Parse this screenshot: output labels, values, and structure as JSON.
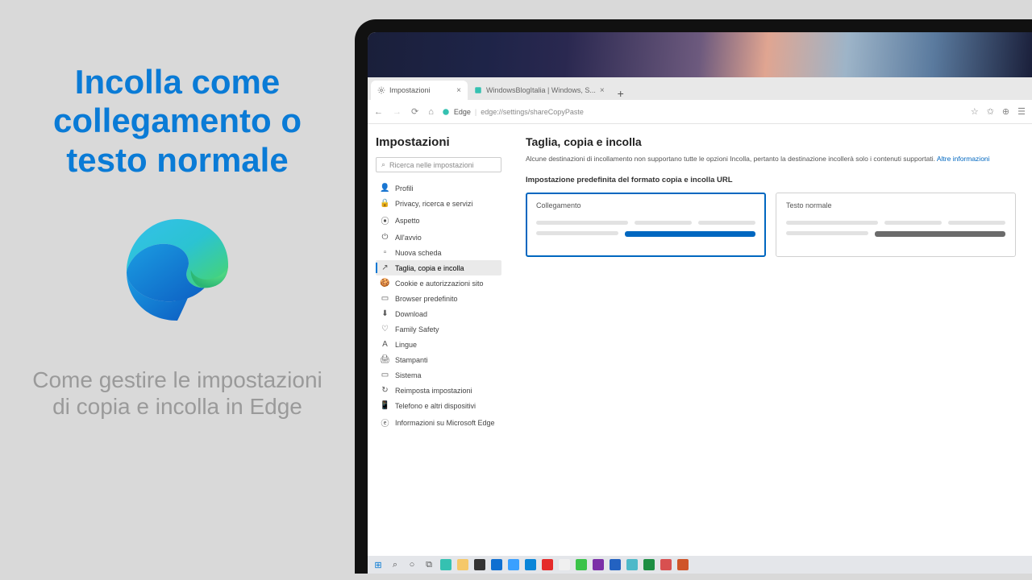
{
  "headline": "Incolla come collegamento o testo normale",
  "subhead": "Come gestire le impostazioni di copia e incolla in Edge",
  "tabs": [
    {
      "label": "Impostazioni"
    },
    {
      "label": "WindowsBlogItalia | Windows, S..."
    }
  ],
  "address": {
    "scheme": "Edge",
    "path": "edge://settings/shareCopyPaste"
  },
  "sidebar": {
    "title": "Impostazioni",
    "search_placeholder": "Ricerca nelle impostazioni",
    "items": [
      {
        "icon": "profile-icon",
        "glyph": "👤",
        "label": "Profili"
      },
      {
        "icon": "lock-icon",
        "glyph": "🔒",
        "label": "Privacy, ricerca e servizi"
      },
      {
        "icon": "appearance-icon",
        "glyph": "⦿",
        "label": "Aspetto"
      },
      {
        "icon": "power-icon",
        "glyph": "⏻",
        "label": "All'avvio"
      },
      {
        "icon": "newtab-icon",
        "glyph": "▫",
        "label": "Nuova scheda"
      },
      {
        "icon": "copy-icon",
        "glyph": "↗",
        "label": "Taglia, copia e incolla"
      },
      {
        "icon": "cookie-icon",
        "glyph": "🍪",
        "label": "Cookie e autorizzazioni sito"
      },
      {
        "icon": "browser-icon",
        "glyph": "▭",
        "label": "Browser predefinito"
      },
      {
        "icon": "download-icon",
        "glyph": "⬇",
        "label": "Download"
      },
      {
        "icon": "family-icon",
        "glyph": "♡",
        "label": "Family Safety"
      },
      {
        "icon": "language-icon",
        "glyph": "A",
        "label": "Lingue"
      },
      {
        "icon": "printer-icon",
        "glyph": "🖨",
        "label": "Stampanti"
      },
      {
        "icon": "system-icon",
        "glyph": "▭",
        "label": "Sistema"
      },
      {
        "icon": "reset-icon",
        "glyph": "↻",
        "label": "Reimposta impostazioni"
      },
      {
        "icon": "phone-icon",
        "glyph": "📱",
        "label": "Telefono e altri dispositivi"
      },
      {
        "icon": "edge-icon",
        "glyph": "ⓔ",
        "label": "Informazioni su Microsoft Edge"
      }
    ],
    "active_index": 5
  },
  "main": {
    "title": "Taglia, copia e incolla",
    "description": "Alcune destinazioni di incollamento non supportano tutte le opzioni Incolla, pertanto la destinazione incollerà solo i contenuti supportati.",
    "more_info": "Altre informazioni",
    "section_label": "Impostazione predefinita del formato copia e incolla URL",
    "cards": [
      {
        "title": "Collegamento",
        "selected": true,
        "accent": "blue"
      },
      {
        "title": "Testo normale",
        "selected": false,
        "accent": "dark"
      }
    ]
  },
  "taskbar": {
    "items": [
      {
        "name": "start-icon",
        "color": "#0078d4",
        "glyph": "⊞"
      },
      {
        "name": "search-icon",
        "color": "#555",
        "glyph": "⌕"
      },
      {
        "name": "cortana-icon",
        "color": "#555",
        "glyph": "○"
      },
      {
        "name": "taskview-icon",
        "color": "#555",
        "glyph": "⧉"
      },
      {
        "name": "edge-taskbar-icon",
        "tile": "#35c1b1"
      },
      {
        "name": "explorer-icon",
        "tile": "#f5c869"
      },
      {
        "name": "store-icon",
        "tile": "#333"
      },
      {
        "name": "mail-icon",
        "tile": "#0f6fd1"
      },
      {
        "name": "todo-icon",
        "tile": "#3aa0ff"
      },
      {
        "name": "phone-icon",
        "tile": "#0985d8"
      },
      {
        "name": "youtube-icon",
        "tile": "#e52b2b"
      },
      {
        "name": "whiteboard-icon",
        "tile": "#f0f0f0"
      },
      {
        "name": "line-icon",
        "tile": "#3ac34a"
      },
      {
        "name": "onenote-icon",
        "tile": "#7b2fa8"
      },
      {
        "name": "word-icon",
        "tile": "#2362c1"
      },
      {
        "name": "files-icon",
        "tile": "#4db9c9"
      },
      {
        "name": "excel-icon",
        "tile": "#1d8e43"
      },
      {
        "name": "figma-icon",
        "tile": "#d85050"
      },
      {
        "name": "powerpoint-icon",
        "tile": "#cf5428"
      }
    ]
  }
}
